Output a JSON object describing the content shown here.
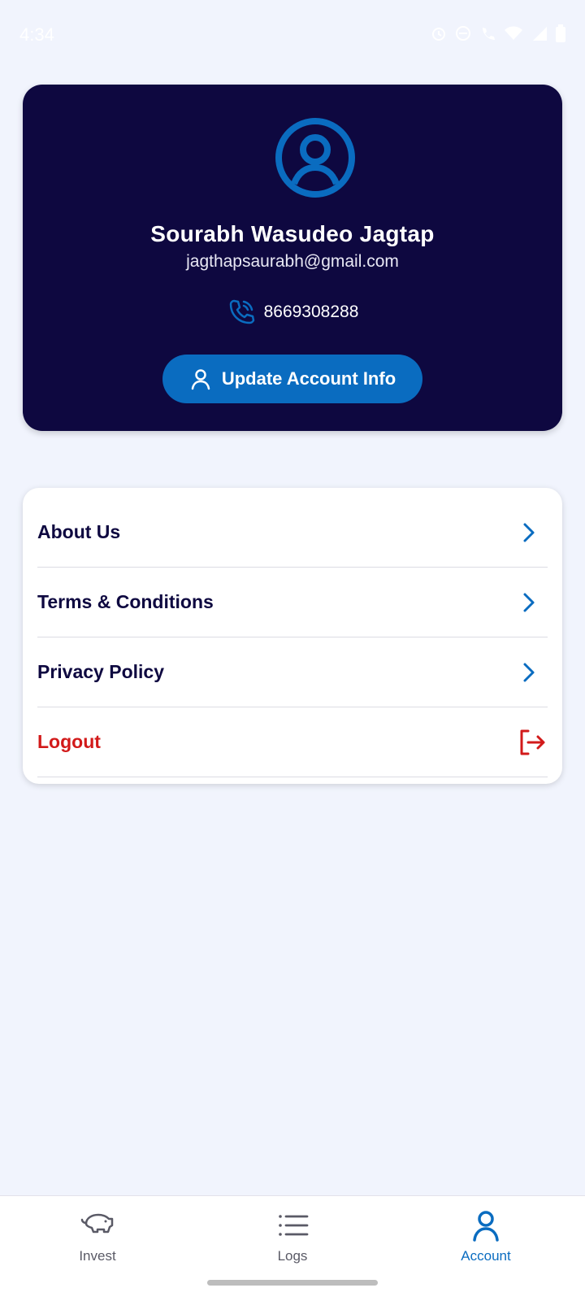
{
  "status_bar": {
    "time": "4:34"
  },
  "profile": {
    "name": "Sourabh Wasudeo Jagtap",
    "email": "jagthapsaurabh@gmail.com",
    "phone": "8669308288",
    "update_button_label": "Update Account Info"
  },
  "menu": {
    "items": [
      {
        "label": "About Us",
        "icon": "chevron-right-icon"
      },
      {
        "label": "Terms & Conditions",
        "icon": "chevron-right-icon"
      },
      {
        "label": "Privacy Policy",
        "icon": "chevron-right-icon"
      },
      {
        "label": "Logout",
        "icon": "logout-icon"
      }
    ]
  },
  "bottom_nav": {
    "items": [
      {
        "label": "Invest",
        "icon": "piggy-bank-icon",
        "active": false
      },
      {
        "label": "Logs",
        "icon": "list-icon",
        "active": false
      },
      {
        "label": "Account",
        "icon": "user-icon",
        "active": true
      }
    ]
  },
  "colors": {
    "background": "#f1f4fd",
    "profile_card": "#0e0840",
    "accent": "#0a6cc0",
    "logout": "#d21a1a",
    "menu_text": "#0e0840"
  }
}
